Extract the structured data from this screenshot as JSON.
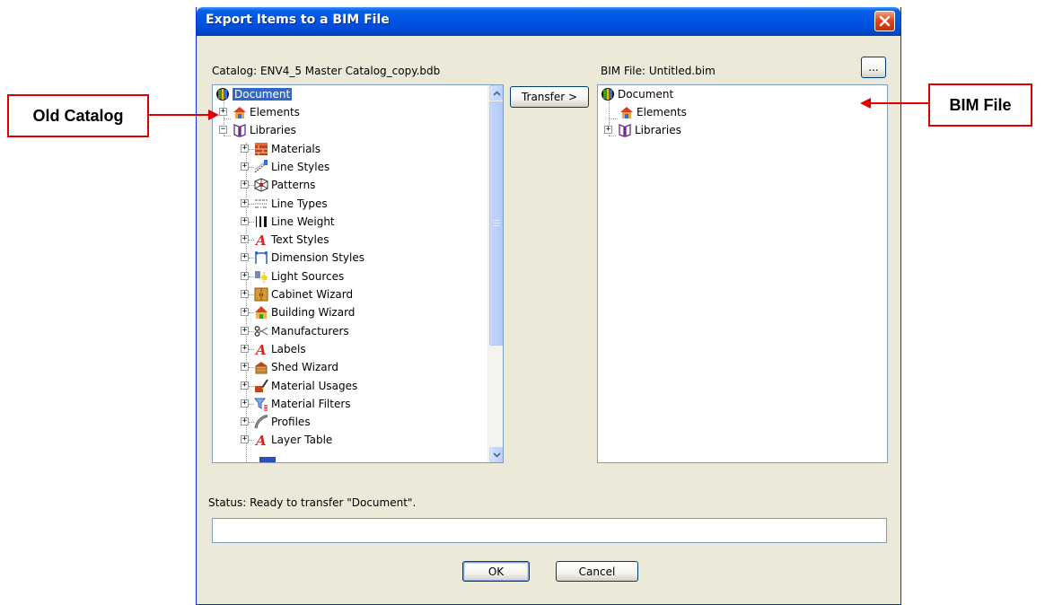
{
  "window": {
    "title": "Export Items to a BIM File",
    "close_icon": "close-icon"
  },
  "catalog": {
    "label": "Catalog: ENV4_5 Master Catalog_copy.bdb",
    "tree": {
      "root": "Document",
      "items": [
        {
          "label": "Elements",
          "icon": "house-icon"
        },
        {
          "label": "Libraries",
          "icon": "book-icon"
        },
        {
          "label": "Materials",
          "icon": "bricks-icon"
        },
        {
          "label": "Line Styles",
          "icon": "line-styles-icon"
        },
        {
          "label": "Patterns",
          "icon": "patterns-icon"
        },
        {
          "label": "Line Types",
          "icon": "line-types-icon"
        },
        {
          "label": "Line Weight",
          "icon": "line-weight-icon"
        },
        {
          "label": "Text Styles",
          "icon": "text-a-icon"
        },
        {
          "label": "Dimension Styles",
          "icon": "dimension-icon"
        },
        {
          "label": "Light Sources",
          "icon": "light-icon"
        },
        {
          "label": "Cabinet Wizard",
          "icon": "cabinet-icon"
        },
        {
          "label": "Building Wizard",
          "icon": "building-icon"
        },
        {
          "label": "Manufacturers",
          "icon": "scissors-icon"
        },
        {
          "label": "Labels",
          "icon": "text-a-icon"
        },
        {
          "label": "Shed Wizard",
          "icon": "shed-icon"
        },
        {
          "label": "Material Usages",
          "icon": "paint-icon"
        },
        {
          "label": "Material Filters",
          "icon": "filter-icon"
        },
        {
          "label": "Profiles",
          "icon": "profile-icon"
        },
        {
          "label": "Layer Table",
          "icon": "text-a-icon"
        }
      ]
    }
  },
  "transfer_button": "Transfer >",
  "bim": {
    "label": "BIM File: Untitled.bim",
    "browse_button": "...",
    "tree": {
      "root": "Document",
      "items": [
        {
          "label": "Elements",
          "icon": "house-icon"
        },
        {
          "label": "Libraries",
          "icon": "book-icon"
        }
      ]
    }
  },
  "status": {
    "text": "Status:  Ready to transfer \"Document\".",
    "progress": 0
  },
  "buttons": {
    "ok": "OK",
    "cancel": "Cancel"
  },
  "callouts": {
    "left": "Old Catalog",
    "right": "BIM File"
  },
  "colors": {
    "titlebar": "#0054e3",
    "callout_border": "#e00000",
    "selection": "#316ac5"
  }
}
